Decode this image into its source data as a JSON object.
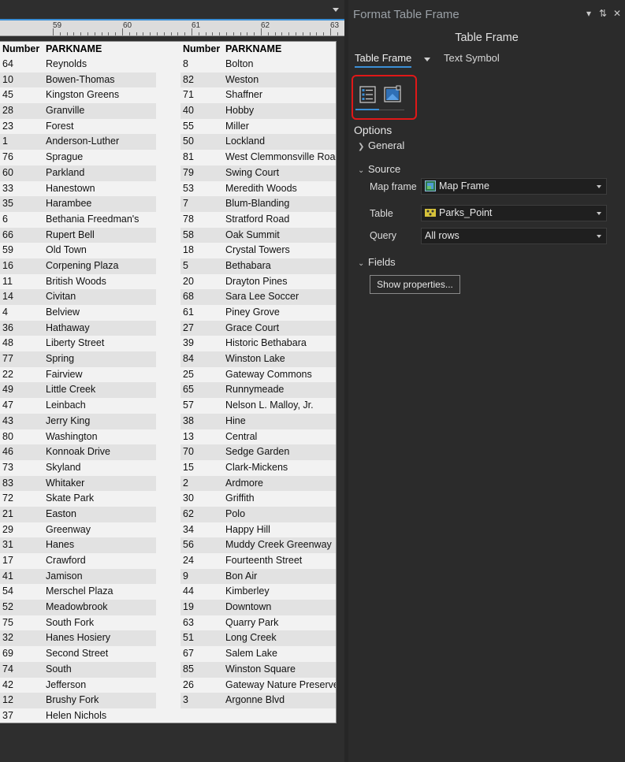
{
  "ruler": {
    "labels": [
      "59",
      "60",
      "61",
      "62",
      "63"
    ]
  },
  "table": {
    "headers": {
      "number": "Number",
      "name": "PARKNAME"
    },
    "column1": [
      [
        "64",
        "Reynolds"
      ],
      [
        "10",
        "Bowen-Thomas"
      ],
      [
        "45",
        "Kingston Greens"
      ],
      [
        "28",
        "Granville"
      ],
      [
        "23",
        "Forest"
      ],
      [
        "1",
        "Anderson-Luther"
      ],
      [
        "76",
        "Sprague"
      ],
      [
        "60",
        "Parkland"
      ],
      [
        "33",
        "Hanestown"
      ],
      [
        "35",
        "Harambee"
      ],
      [
        "6",
        "Bethania Freedman's"
      ],
      [
        "66",
        "Rupert Bell"
      ],
      [
        "59",
        "Old Town"
      ],
      [
        "16",
        "Corpening Plaza"
      ],
      [
        "11",
        "British Woods"
      ],
      [
        "14",
        "Civitan"
      ],
      [
        "4",
        "Belview"
      ],
      [
        "36",
        "Hathaway"
      ],
      [
        "48",
        "Liberty Street"
      ],
      [
        "77",
        "Spring"
      ],
      [
        "22",
        "Fairview"
      ],
      [
        "49",
        "Little Creek"
      ],
      [
        "47",
        "Leinbach"
      ],
      [
        "43",
        "Jerry King"
      ],
      [
        "80",
        "Washington"
      ],
      [
        "46",
        "Konnoak Drive"
      ],
      [
        "73",
        "Skyland"
      ],
      [
        "83",
        "Whitaker"
      ],
      [
        "72",
        "Skate Park"
      ],
      [
        "21",
        "Easton"
      ],
      [
        "29",
        "Greenway"
      ],
      [
        "31",
        "Hanes"
      ],
      [
        "17",
        "Crawford"
      ],
      [
        "41",
        "Jamison"
      ],
      [
        "54",
        "Merschel Plaza"
      ],
      [
        "52",
        "Meadowbrook"
      ],
      [
        "75",
        "South Fork"
      ],
      [
        "32",
        "Hanes Hosiery"
      ],
      [
        "69",
        "Second Street"
      ],
      [
        "74",
        "South"
      ],
      [
        "42",
        "Jefferson"
      ],
      [
        "12",
        "Brushy Fork"
      ],
      [
        "37",
        "Helen Nichols"
      ]
    ],
    "column2": [
      [
        "8",
        "Bolton"
      ],
      [
        "82",
        "Weston"
      ],
      [
        "71",
        "Shaffner"
      ],
      [
        "40",
        "Hobby"
      ],
      [
        "55",
        "Miller"
      ],
      [
        "50",
        "Lockland"
      ],
      [
        "81",
        "West Clemmonsville Road"
      ],
      [
        "79",
        "Swing Court"
      ],
      [
        "53",
        "Meredith Woods"
      ],
      [
        "7",
        "Blum-Blanding"
      ],
      [
        "78",
        "Stratford Road"
      ],
      [
        "58",
        "Oak Summit"
      ],
      [
        "18",
        "Crystal Towers"
      ],
      [
        "5",
        "Bethabara"
      ],
      [
        "20",
        "Drayton Pines"
      ],
      [
        "68",
        "Sara Lee Soccer"
      ],
      [
        "61",
        "Piney Grove"
      ],
      [
        "27",
        "Grace Court"
      ],
      [
        "39",
        "Historic Bethabara"
      ],
      [
        "84",
        "Winston Lake"
      ],
      [
        "25",
        "Gateway Commons"
      ],
      [
        "65",
        "Runnymeade"
      ],
      [
        "57",
        "Nelson L. Malloy, Jr."
      ],
      [
        "38",
        "Hine"
      ],
      [
        "13",
        "Central"
      ],
      [
        "70",
        "Sedge Garden"
      ],
      [
        "15",
        "Clark-Mickens"
      ],
      [
        "2",
        "Ardmore"
      ],
      [
        "30",
        "Griffith"
      ],
      [
        "62",
        "Polo"
      ],
      [
        "34",
        "Happy Hill"
      ],
      [
        "56",
        "Muddy Creek Greenway"
      ],
      [
        "24",
        "Fourteenth Street"
      ],
      [
        "9",
        "Bon Air"
      ],
      [
        "44",
        "Kimberley"
      ],
      [
        "19",
        "Downtown"
      ],
      [
        "63",
        "Quarry Park"
      ],
      [
        "51",
        "Long Creek"
      ],
      [
        "67",
        "Salem Lake"
      ],
      [
        "85",
        "Winston Square"
      ],
      [
        "26",
        "Gateway Nature Preserve"
      ],
      [
        "3",
        "Argonne Blvd"
      ]
    ]
  },
  "pane": {
    "title": "Format Table Frame",
    "subtitle": "Table Frame",
    "tabs": {
      "active": "Table Frame",
      "other": "Text Symbol"
    },
    "options_heading": "Options",
    "sections": {
      "general": "General",
      "source": "Source",
      "fields": "Fields"
    },
    "source": {
      "map_frame_label": "Map frame",
      "map_frame_value": "Map Frame",
      "table_label": "Table",
      "table_value": "Parks_Point",
      "query_label": "Query",
      "query_value": "All rows"
    },
    "show_properties_label": "Show properties...",
    "colors": {
      "accent": "#3b8fd6",
      "highlight": "#e01818",
      "pane_bg": "#2b2b2b"
    }
  }
}
